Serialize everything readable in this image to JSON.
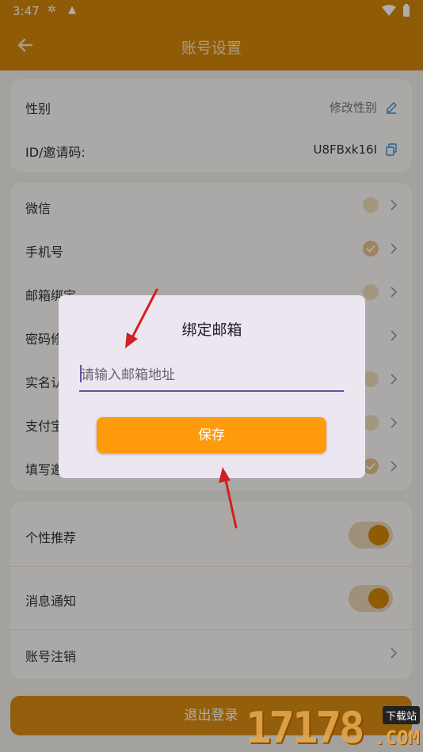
{
  "status_bar": {
    "time": "3:47"
  },
  "app_bar": {
    "title": "账号设置"
  },
  "profile_card": {
    "gender": {
      "label": "性别",
      "action": "修改性别"
    },
    "invite": {
      "label": "ID/邀请码:",
      "value": "U8FBxk16I"
    }
  },
  "binding_card": {
    "items": [
      {
        "label": "微信"
      },
      {
        "label": "手机号"
      },
      {
        "label": "邮箱绑定"
      },
      {
        "label": "密码修改"
      },
      {
        "label": "实名认证"
      },
      {
        "label": "支付宝"
      },
      {
        "label": "填写邀请码"
      }
    ]
  },
  "prefs_card": {
    "personal_recommend": {
      "label": "个性推荐"
    },
    "notifications": {
      "label": "消息通知"
    },
    "delete_account": {
      "label": "账号注销"
    }
  },
  "logout_label": "退出登录",
  "dialog": {
    "title": "绑定邮箱",
    "email_placeholder": "请输入邮箱地址",
    "save_label": "保存"
  },
  "watermark": {
    "number": "17178",
    "tag": "下载站",
    "domain": ".COM"
  },
  "colors": {
    "accent": "#d4870a",
    "save_button": "#ff9a0d",
    "field_underline": "#6750a4",
    "annotation": "#d31f1f"
  }
}
